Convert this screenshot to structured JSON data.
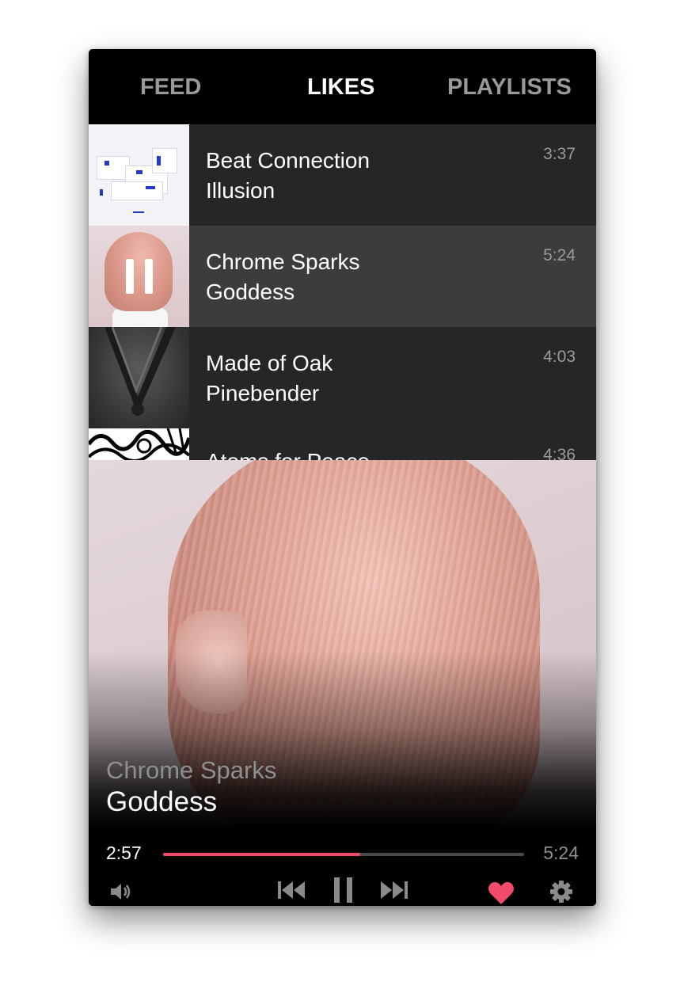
{
  "tabs": [
    {
      "label": "FEED",
      "active": false
    },
    {
      "label": "LIKES",
      "active": true
    },
    {
      "label": "PLAYLISTS",
      "active": false
    }
  ],
  "tracks": [
    {
      "artist": "Beat Connection",
      "title": "Illusion",
      "duration": "3:37",
      "playing": false
    },
    {
      "artist": "Chrome Sparks",
      "title": "Goddess",
      "duration": "5:24",
      "playing": true
    },
    {
      "artist": "Made of Oak",
      "title": "Pinebender",
      "duration": "4:03",
      "playing": false
    },
    {
      "artist": "Atoms for Peace",
      "title": "",
      "duration": "4:36",
      "playing": false
    }
  ],
  "now_playing": {
    "artist": "Chrome Sparks",
    "title": "Goddess",
    "elapsed": "2:57",
    "total": "5:24",
    "progress_fraction": 0.546
  },
  "controls": {
    "volume_icon": "volume-icon",
    "prev_icon": "previous-track-icon",
    "pause_icon": "pause-icon",
    "next_icon": "next-track-icon",
    "like_icon": "heart-icon",
    "settings_icon": "gear-icon"
  },
  "colors": {
    "accent": "#f24a6a",
    "list_background": "#262626",
    "playing_row_background": "#3c3c3c",
    "muted_text": "#9a9a9a"
  }
}
